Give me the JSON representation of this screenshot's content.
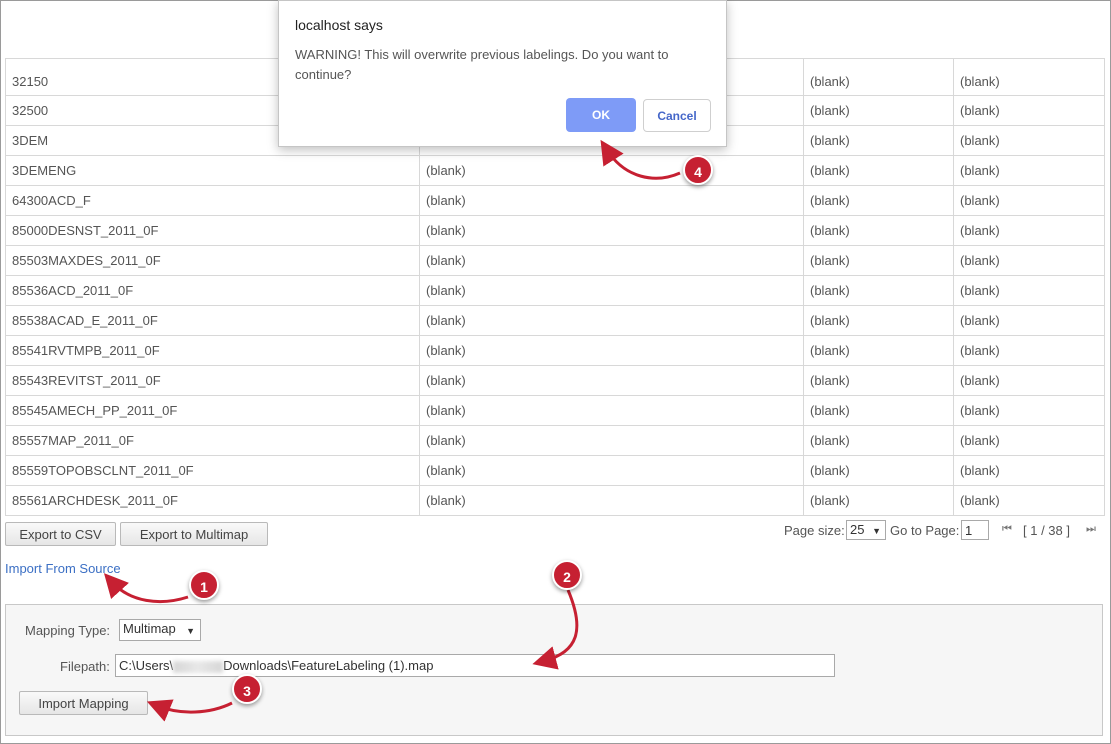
{
  "table": {
    "rows": [
      [
        "32150",
        "",
        "(blank)",
        "(blank)"
      ],
      [
        "32500",
        "",
        "(blank)",
        "(blank)"
      ],
      [
        "3DEM",
        "",
        "(blank)",
        "(blank)"
      ],
      [
        "3DEMENG",
        "(blank)",
        "(blank)",
        "(blank)"
      ],
      [
        "64300ACD_F",
        "(blank)",
        "(blank)",
        "(blank)"
      ],
      [
        "85000DESNST_2011_0F",
        "(blank)",
        "(blank)",
        "(blank)"
      ],
      [
        "85503MAXDES_2011_0F",
        "(blank)",
        "(blank)",
        "(blank)"
      ],
      [
        "85536ACD_2011_0F",
        "(blank)",
        "(blank)",
        "(blank)"
      ],
      [
        "85538ACAD_E_2011_0F",
        "(blank)",
        "(blank)",
        "(blank)"
      ],
      [
        "85541RVTMPB_2011_0F",
        "(blank)",
        "(blank)",
        "(blank)"
      ],
      [
        "85543REVITST_2011_0F",
        "(blank)",
        "(blank)",
        "(blank)"
      ],
      [
        "85545AMECH_PP_2011_0F",
        "(blank)",
        "(blank)",
        "(blank)"
      ],
      [
        "85557MAP_2011_0F",
        "(blank)",
        "(blank)",
        "(blank)"
      ],
      [
        "85559TOPOBSCLNT_2011_0F",
        "(blank)",
        "(blank)",
        "(blank)"
      ],
      [
        "85561ARCHDESK_2011_0F",
        "(blank)",
        "(blank)",
        "(blank)"
      ]
    ]
  },
  "toolbar": {
    "export_csv": "Export to CSV",
    "export_multimap": "Export to Multimap"
  },
  "pager": {
    "page_size_label": "Page size:",
    "page_size_value": "25",
    "go_to_label": "Go to Page:",
    "go_to_value": "1",
    "first_icon": "first-page-icon",
    "last_icon": "last-page-icon",
    "page_status": "[ 1 / 38 ]"
  },
  "import_link": "Import From Source",
  "import_panel": {
    "mapping_type_label": "Mapping Type:",
    "mapping_type_value": "Multimap",
    "filepath_label": "Filepath:",
    "filepath_prefix": "C:\\Users\\",
    "filepath_suffix": "Downloads\\FeatureLabeling (1).map",
    "import_button": "Import Mapping"
  },
  "dialog": {
    "title": "localhost says",
    "message": "WARNING! This will overwrite previous labelings. Do you want to continue?",
    "ok": "OK",
    "cancel": "Cancel"
  },
  "callouts": [
    "1",
    "2",
    "3",
    "4"
  ],
  "colors": {
    "callout_red": "#c62032",
    "ok_button": "#7e9bf7",
    "link_blue": "#3b6fc4"
  }
}
